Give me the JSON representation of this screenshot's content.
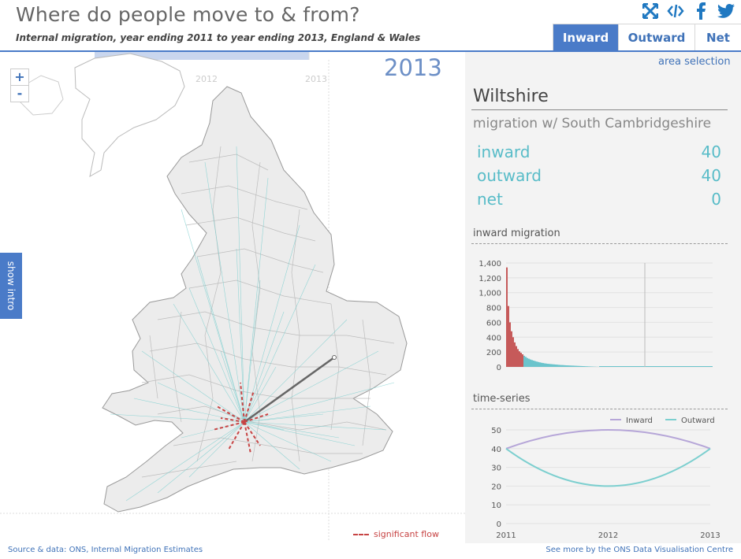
{
  "header": {
    "title": "Where do people move to & from?",
    "subtitle": "Internal migration, year ending 2011 to year ending 2013, England & Wales",
    "icons": [
      "expand-icon",
      "embed-icon",
      "facebook-icon",
      "twitter-icon"
    ],
    "tabs": [
      {
        "label": "Inward",
        "active": true
      },
      {
        "label": "Outward",
        "active": false
      },
      {
        "label": "Net",
        "active": false
      }
    ]
  },
  "map": {
    "zoom_in": "+",
    "zoom_out": "-",
    "year": "2013",
    "slider_ticks": [
      "2012",
      "2013"
    ],
    "intro_label": "show intro",
    "legend_label": "significant flow"
  },
  "panel": {
    "area_selection": "area selection",
    "region": "Wiltshire",
    "pair": "migration w/ South Cambridgeshire",
    "stats": [
      {
        "label": "inward",
        "value": "40"
      },
      {
        "label": "outward",
        "value": "40"
      },
      {
        "label": "net",
        "value": "0"
      }
    ],
    "hist_title": "inward migration",
    "ts_title": "time-series"
  },
  "chart_data": [
    {
      "type": "bar",
      "title": "inward migration",
      "ylim": [
        0,
        1400
      ],
      "y_ticks": [
        "0",
        "200",
        "400",
        "600",
        "800",
        "1,000",
        "1,200",
        "1,400"
      ],
      "values": [
        1340,
        820,
        600,
        480,
        400,
        330,
        280,
        240,
        210,
        190,
        170,
        150,
        135,
        120,
        110,
        100,
        92,
        85,
        78,
        72,
        66,
        61,
        56,
        52,
        48,
        45,
        42,
        40,
        38,
        36,
        34,
        32,
        30,
        28,
        26,
        25,
        24,
        22,
        21,
        20,
        19,
        18,
        17,
        16,
        15,
        14,
        13,
        12,
        11,
        10,
        9,
        8,
        7,
        6,
        5,
        4,
        3,
        2,
        1
      ],
      "highlight_count": 11,
      "marker_index": 20,
      "colors": {
        "highlight": "#c65a5a",
        "bar": "#6bc4cc",
        "marker": "#bbbbbb"
      }
    },
    {
      "type": "line",
      "title": "time-series",
      "x": [
        "2011",
        "2012",
        "2013"
      ],
      "ylim": [
        0,
        50
      ],
      "y_ticks": [
        "0",
        "10",
        "20",
        "30",
        "40",
        "50"
      ],
      "series": [
        {
          "name": "Inward",
          "values": [
            40,
            50,
            40
          ],
          "color": "#b6a6d8"
        },
        {
          "name": "Outward",
          "values": [
            40,
            20,
            40
          ],
          "color": "#7ccfcf"
        }
      ],
      "legend": "top-right"
    }
  ],
  "footer": {
    "source": "Source & data: ONS, Internal Migration Estimates",
    "more": "See more by the ONS Data Visualisation Centre"
  }
}
